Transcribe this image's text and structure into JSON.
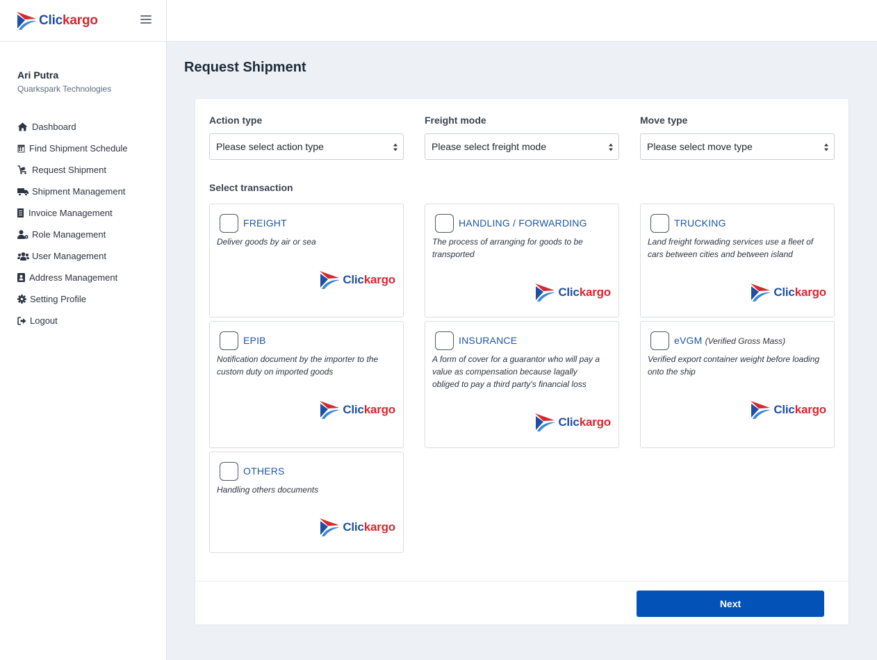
{
  "brand": {
    "name_part1": "Clic",
    "name_part2": "kargo",
    "blue": "#1f4fa3",
    "red": "#d7272f"
  },
  "user": {
    "name": "Ari Putra",
    "company": "Quarkspark Technologies"
  },
  "menu": [
    {
      "label": "Dashboard",
      "icon": "home-icon"
    },
    {
      "label": "Find Shipment Schedule",
      "icon": "calendar-icon"
    },
    {
      "label": "Request Shipment",
      "icon": "cart-icon"
    },
    {
      "label": "Shipment Management",
      "icon": "truck-icon"
    },
    {
      "label": "Invoice Management",
      "icon": "receipt-icon"
    },
    {
      "label": "Role Management",
      "icon": "user-gear-icon"
    },
    {
      "label": "User Management",
      "icon": "users-icon"
    },
    {
      "label": "Address Management",
      "icon": "address-book-icon"
    },
    {
      "label": "Setting Profile",
      "icon": "gear-icon"
    },
    {
      "label": "Logout",
      "icon": "logout-icon"
    }
  ],
  "page": {
    "title": "Request Shipment"
  },
  "form": {
    "action_type": {
      "label": "Action type",
      "placeholder": "Please select action type"
    },
    "freight_mode": {
      "label": "Freight mode",
      "placeholder": "Please select freight mode"
    },
    "move_type": {
      "label": "Move type",
      "placeholder": "Please select move type"
    },
    "select_transaction_label": "Select transaction"
  },
  "transactions": [
    {
      "title": "FREIGHT",
      "subtitle": "",
      "desc": "Deliver goods by air or sea"
    },
    {
      "title": "HANDLING / FORWARDING",
      "subtitle": "",
      "desc": "The process of arranging for goods to be transported"
    },
    {
      "title": "TRUCKING",
      "subtitle": "",
      "desc": "Land freight forwading services use a fleet of cars between cities and between island"
    },
    {
      "title": "EPIB",
      "subtitle": "",
      "desc": "Notification document by the importer to the custom duty on imported goods"
    },
    {
      "title": "INSURANCE",
      "subtitle": "",
      "desc": "A form of cover for a guarantor who will pay a value as compensation because lagally obliged to pay a third party's financial loss"
    },
    {
      "title": "eVGM",
      "subtitle": "(Verified Gross Mass)",
      "desc": "Verified export container weight before loading onto the ship"
    },
    {
      "title": "OTHERS",
      "subtitle": "",
      "desc": "Handling others documents"
    }
  ],
  "footer": {
    "next_label": "Next"
  },
  "colors": {
    "primary": "#0352b8",
    "link": "#1d54a8",
    "background": "#edf0f4"
  }
}
